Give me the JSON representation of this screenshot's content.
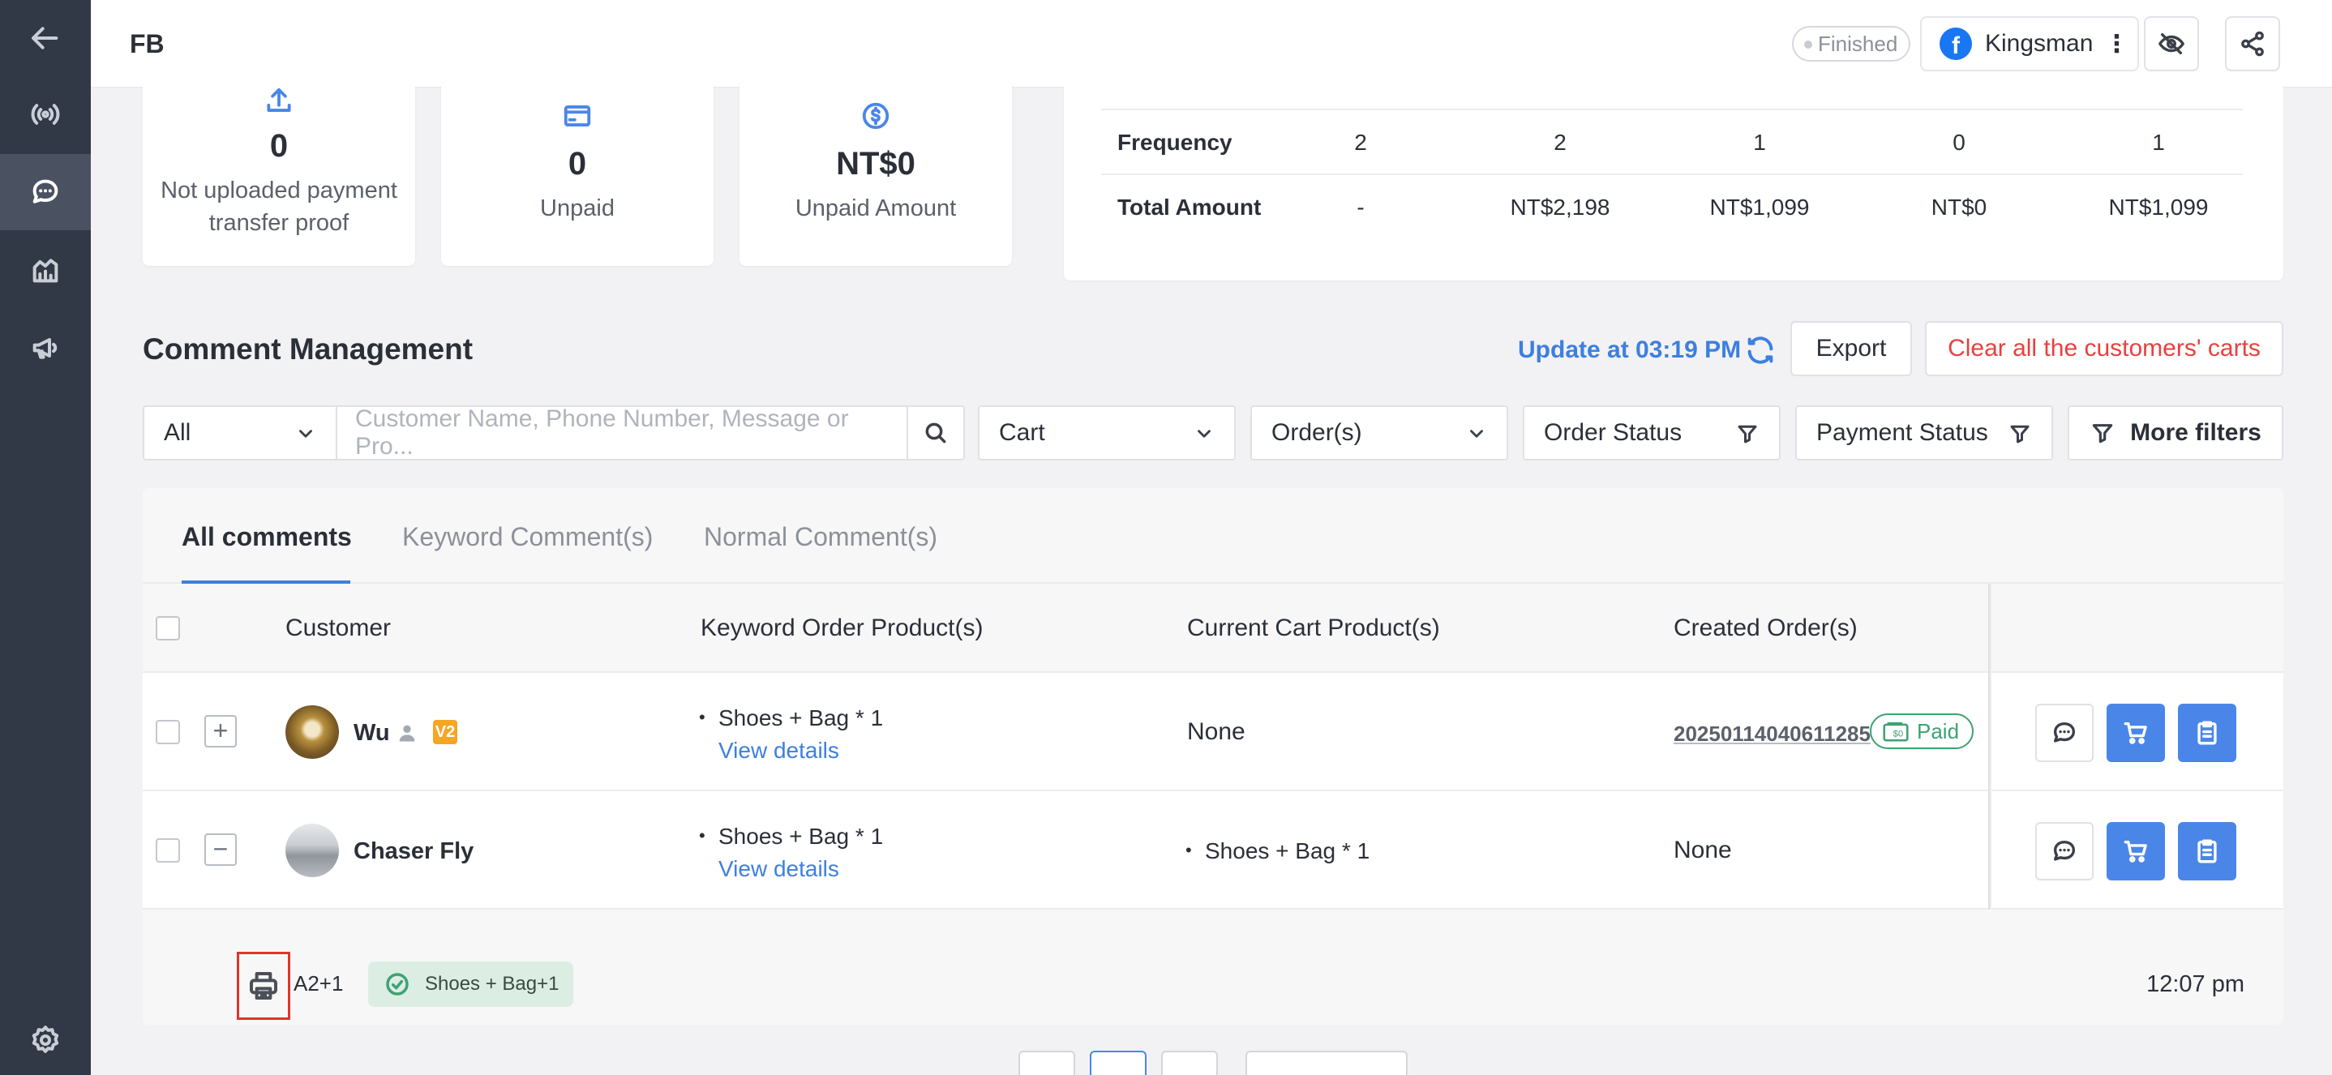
{
  "header": {
    "title": "FB",
    "status": "Finished",
    "account_name": "Kingsman"
  },
  "stats": [
    {
      "icon": "upload-icon",
      "value": "0",
      "label": "Not uploaded payment transfer proof"
    },
    {
      "icon": "card-icon",
      "value": "0",
      "label": "Unpaid"
    },
    {
      "icon": "dollar-icon",
      "value": "NT$0",
      "label": "Unpaid Amount"
    }
  ],
  "summary": {
    "rows": [
      {
        "label": "Frequency",
        "values": [
          "2",
          "2",
          "1",
          "0",
          "1"
        ]
      },
      {
        "label": "Total Amount",
        "values": [
          "-",
          "NT$2,198",
          "NT$1,099",
          "NT$0",
          "NT$1,099"
        ]
      }
    ]
  },
  "comments": {
    "title": "Comment Management",
    "update_text": "Update at 03:19 PM",
    "export_label": "Export",
    "clear_label": "Clear all the customers' carts",
    "filters": {
      "scope": "All",
      "search_placeholder": "Customer Name, Phone Number, Message or Pro...",
      "cart": "Cart",
      "orders": "Order(s)",
      "order_status": "Order Status",
      "payment_status": "Payment Status",
      "more": "More filters"
    },
    "tabs": [
      "All comments",
      "Keyword Comment(s)",
      "Normal Comment(s)"
    ],
    "columns": [
      "Customer",
      "Keyword Order Product(s)",
      "Current Cart Product(s)",
      "Created Order(s)"
    ],
    "rows": [
      {
        "customer": "Wu",
        "expander": "+",
        "vip": "V2",
        "keyword_product": "Shoes + Bag  * 1",
        "view_details": "View details",
        "cart": "None",
        "order_id": "20250114040611285",
        "order_badge": "Paid"
      },
      {
        "customer": "Chaser Fly",
        "expander": "−",
        "keyword_product": "Shoes + Bag  * 1",
        "view_details": "View details",
        "cart": "Shoes + Bag  * 1",
        "order_id": "None"
      }
    ],
    "expanded": {
      "code": "A2+1",
      "chip": "Shoes + Bag+1",
      "time": "12:07 pm"
    }
  },
  "colors": {
    "sidebar": "#313846",
    "accent": "#3d7fe0",
    "danger": "#ea3f3f",
    "success": "#3ea272"
  }
}
